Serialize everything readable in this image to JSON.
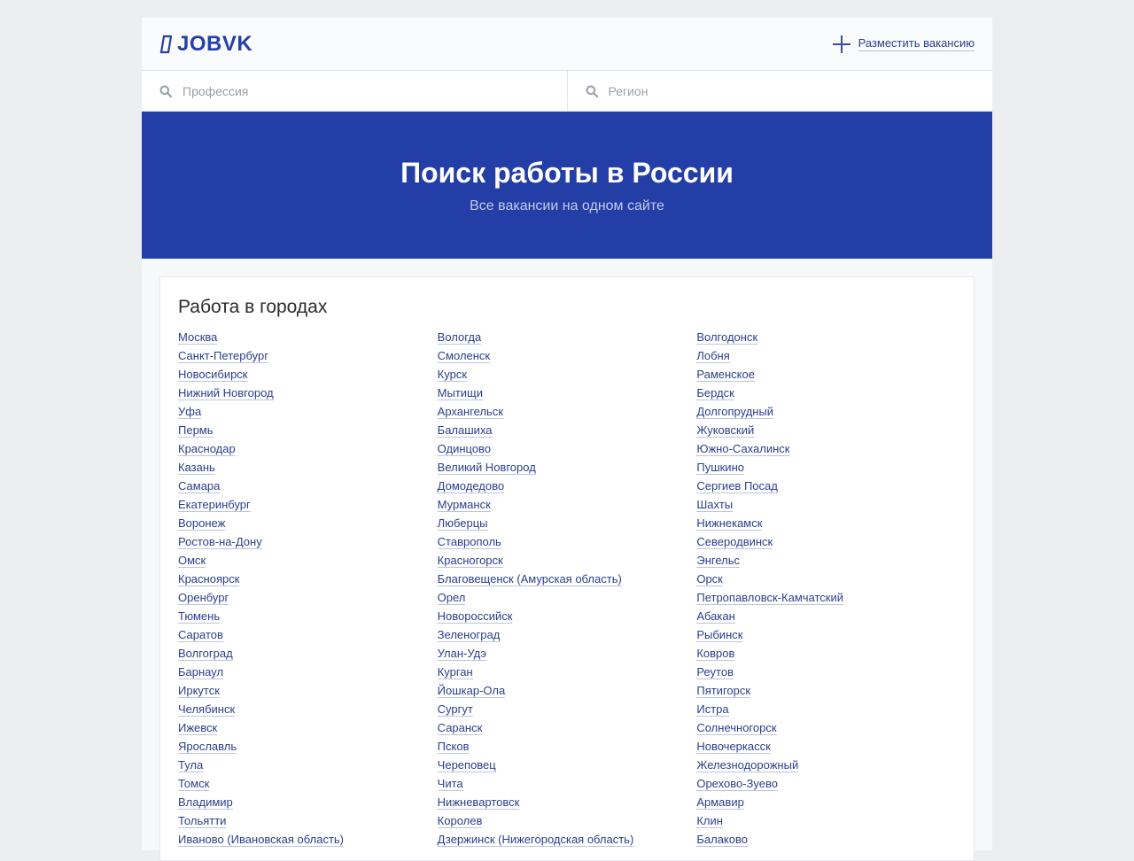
{
  "header": {
    "logo_text": "JOBVK",
    "post_vacancy_label": "Разместить вакансию"
  },
  "search": {
    "profession_placeholder": "Профессия",
    "region_placeholder": "Регион"
  },
  "hero": {
    "title": "Поиск работы в России",
    "subtitle": "Все вакансии на одном сайте"
  },
  "cities": {
    "title": "Работа в городах",
    "columns": [
      [
        "Москва",
        "Санкт-Петербург",
        "Новосибирск",
        "Нижний Новгород",
        "Уфа",
        "Пермь",
        "Краснодар",
        "Казань",
        "Самара",
        "Екатеринбург",
        "Воронеж",
        "Ростов-на-Дону",
        "Омск",
        "Красноярск",
        "Оренбург",
        "Тюмень",
        "Саратов",
        "Волгоград",
        "Барнаул",
        "Иркутск",
        "Челябинск",
        "Ижевск",
        "Ярославль",
        "Тула",
        "Томск",
        "Владимир",
        "Тольятти",
        "Иваново (Ивановская область)"
      ],
      [
        "Вологда",
        "Смоленск",
        "Курск",
        "Мытищи",
        "Архангельск",
        "Балашиха",
        "Одинцово",
        "Великий Новгород",
        "Домодедово",
        "Мурманск",
        "Люберцы",
        "Ставрополь",
        "Красногорск",
        "Благовещенск (Амурская область)",
        "Орел",
        "Новороссийск",
        "Зеленоград",
        "Улан-Удэ",
        "Курган",
        "Йошкар-Ола",
        "Сургут",
        "Саранск",
        "Псков",
        "Череповец",
        "Чита",
        "Нижневартовск",
        "Королев",
        "Дзержинск (Нижегородская область)"
      ],
      [
        "Волгодонск",
        "Лобня",
        "Раменское",
        "Бердск",
        "Долгопрудный",
        "Жуковский",
        "Южно-Сахалинск",
        "Пушкино",
        "Сергиев Посад",
        "Шахты",
        "Нижнекамск",
        "Северодвинск",
        "Энгельс",
        "Орск",
        "Петропавловск-Камчатский",
        "Абакан",
        "Рыбинск",
        "Ковров",
        "Реутов",
        "Пятигорск",
        "Истра",
        "Солнечногорск",
        "Новочеркасск",
        "Железнодорожный",
        "Орехово-Зуево",
        "Армавир",
        "Клин",
        "Балаково"
      ]
    ]
  },
  "colors": {
    "brand": "#2540a8",
    "hero_bg": "#233ea6",
    "link": "#2a3f8f"
  },
  "icons": [
    "logo-mark-icon",
    "plus-icon",
    "search-icon"
  ]
}
